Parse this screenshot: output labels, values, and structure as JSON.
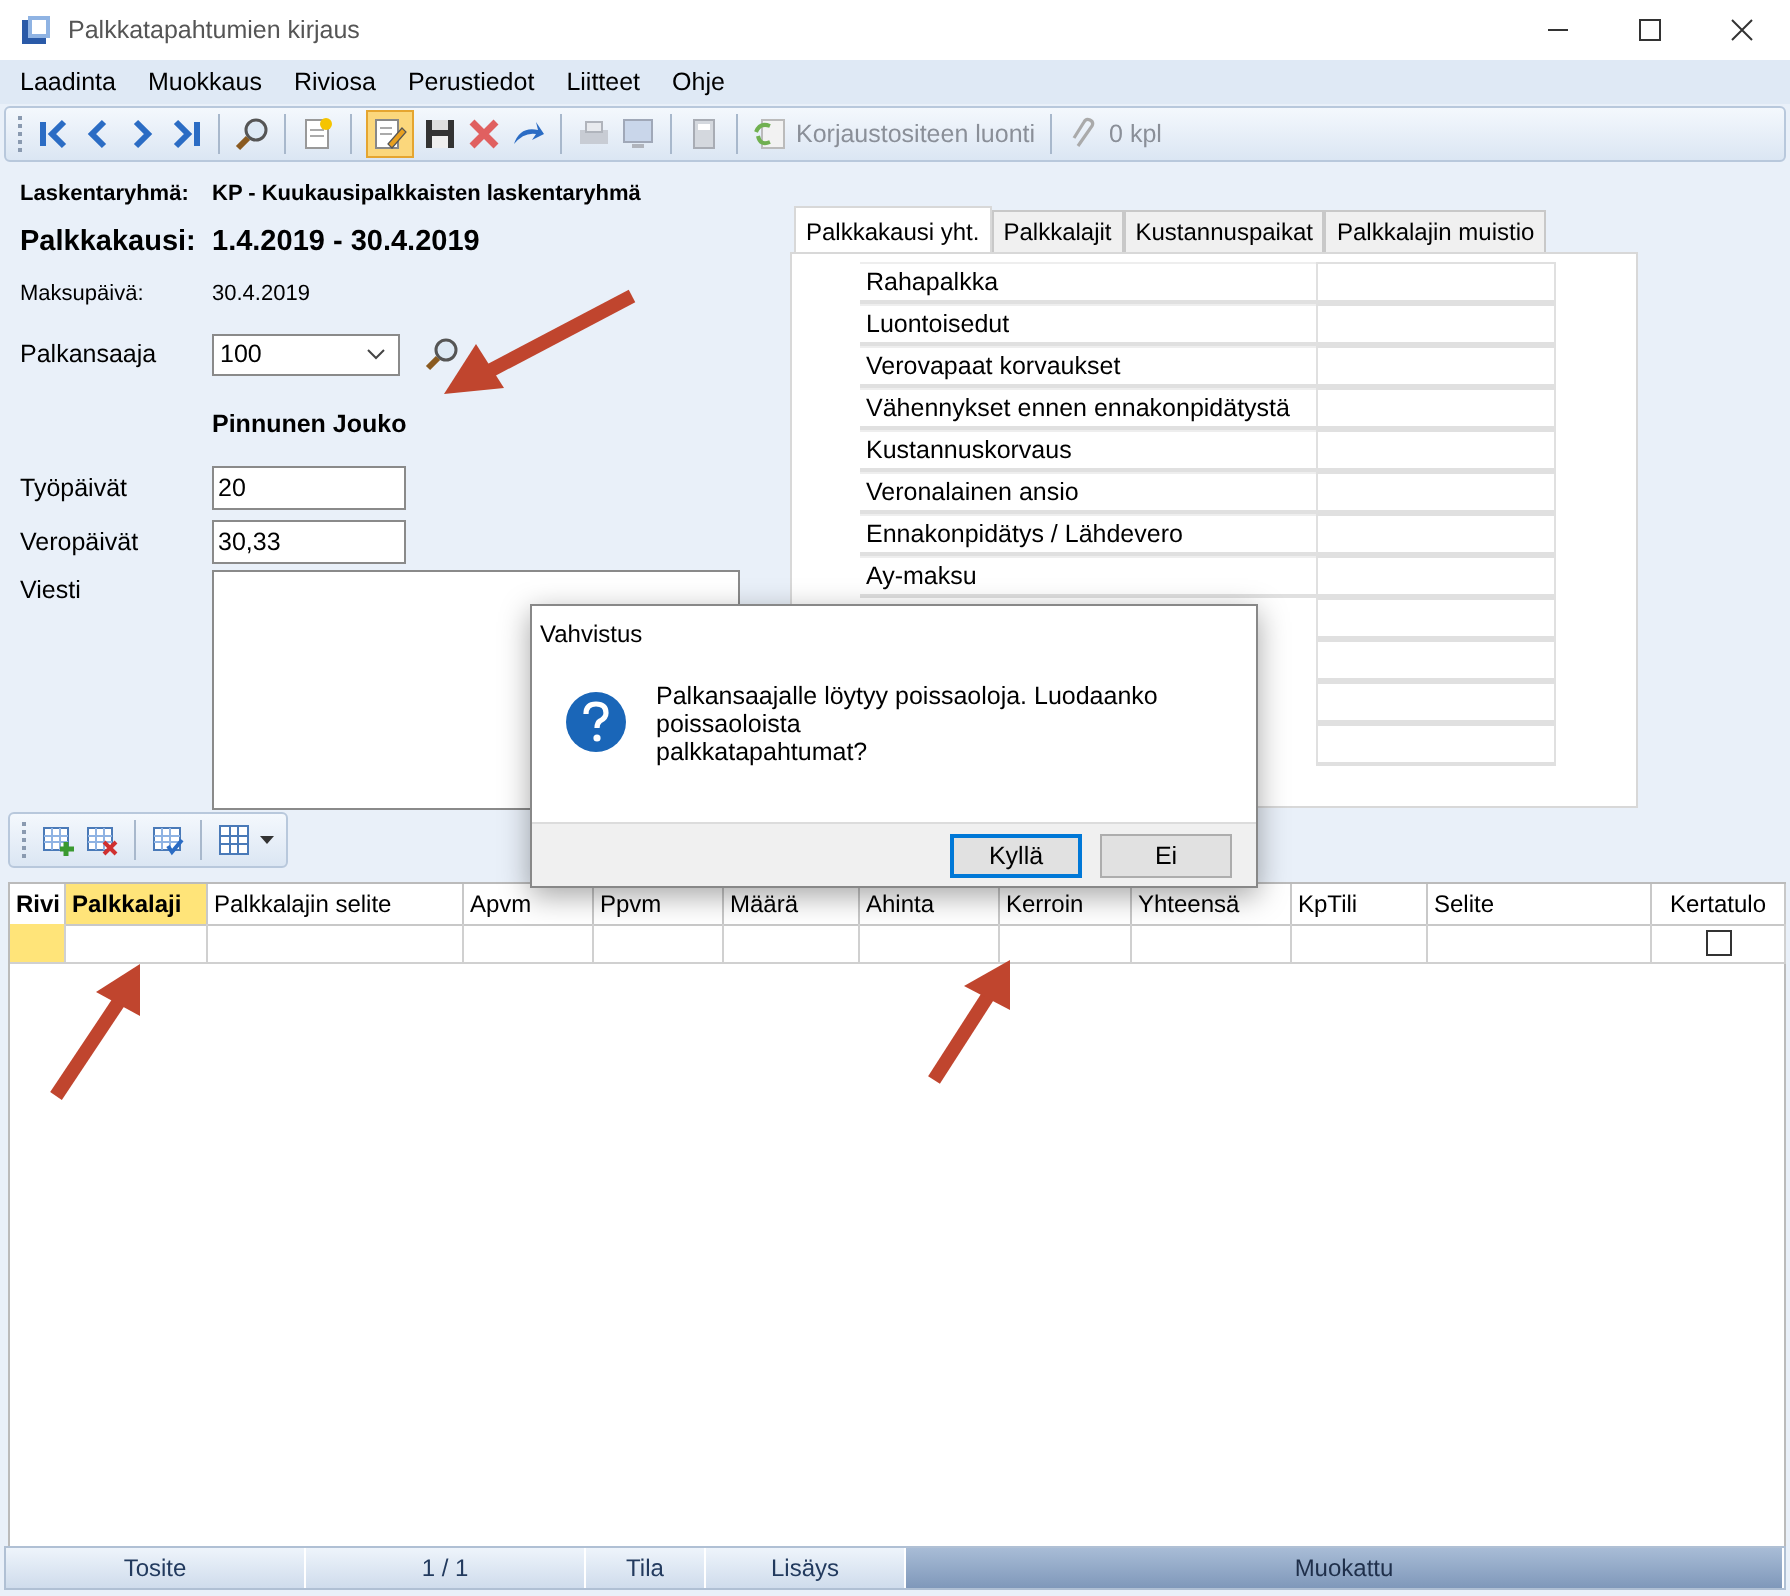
{
  "window": {
    "title": "Palkkatapahtumien kirjaus"
  },
  "menu": [
    "Laadinta",
    "Muokkaus",
    "Riviosa",
    "Perustiedot",
    "Liitteet",
    "Ohje"
  ],
  "toolbar": {
    "edit_active": true,
    "labels": [
      {
        "text": "Korjaustositeen luonti",
        "disabled": true
      },
      {
        "text": "0 kpl",
        "disabled": true
      }
    ]
  },
  "form": {
    "group": {
      "label": "Laskentaryhmä:",
      "value": "KP - Kuukausipalkkaisten laskentaryhmä"
    },
    "period": {
      "label": "Palkkakausi:",
      "value": "1.4.2019 - 30.4.2019"
    },
    "payday": {
      "label": "Maksupäivä:",
      "value": "30.4.2019"
    },
    "employee": {
      "label": "Palkansaaja",
      "value": "100",
      "name": "Pinnunen Jouko"
    },
    "work_days": {
      "label": "Työpäivät",
      "value": "20"
    },
    "tax_days": {
      "label": "Veropäivät",
      "value": "30,33"
    },
    "message": {
      "label": "Viesti"
    }
  },
  "tabs": [
    {
      "label": "Palkkakausi yht.",
      "selected": true
    },
    {
      "label": "Palkkalajit",
      "selected": false
    },
    {
      "label": "Kustannuspaikat",
      "selected": false
    },
    {
      "label": "Palkkalajin muistio",
      "selected": false
    }
  ],
  "summary_rows": [
    "Rahapalkka",
    "Luontoisedut",
    "Verovapaat korvaukset",
    "Vähennykset ennen ennakonpidätystä",
    "Kustannuskorvaus",
    "Veronalainen ansio",
    "Ennakonpidätys / Lähdevero",
    "Ay-maksu"
  ],
  "dialog": {
    "title": "Vahvistus",
    "message_lines": [
      "Palkansaajalle löytyy poissaoloja. Luodaanko",
      "poissaoloista",
      "palkkatapahtumat?"
    ],
    "buttons": [
      {
        "label": "Kyllä",
        "default": true
      },
      {
        "label": "Ei",
        "default": false
      }
    ]
  },
  "grid": {
    "columns": [
      {
        "label": "Rivi",
        "selected": false
      },
      {
        "label": "Palkkalaji",
        "selected": true
      },
      {
        "label": "Palkkalajin selite",
        "selected": false
      },
      {
        "label": "Apvm",
        "selected": false
      },
      {
        "label": "Ppvm",
        "selected": false
      },
      {
        "label": "Määrä",
        "selected": false
      },
      {
        "label": "Ahinta",
        "selected": false
      },
      {
        "label": "Kerroin",
        "selected": false
      },
      {
        "label": "Yhteensä",
        "selected": false
      },
      {
        "label": "KpTili",
        "selected": false
      },
      {
        "label": "Selite",
        "selected": false
      },
      {
        "label": "Kertatulo",
        "selected": false
      }
    ],
    "rows": [
      {
        "current": true,
        "checked": false
      }
    ]
  },
  "status_bar": [
    "Tosite",
    "1 / 1",
    "Tila",
    "Lisäys",
    "Muokattu"
  ]
}
